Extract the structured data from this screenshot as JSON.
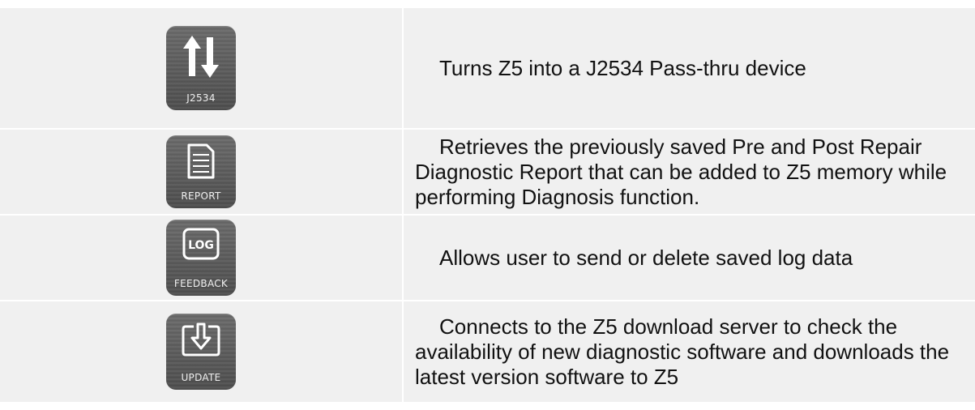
{
  "rows": [
    {
      "icon": "j2534-arrows-icon",
      "label": "J2534",
      "description": "Turns Z5 into a J2534 Pass-thru device"
    },
    {
      "icon": "report-document-icon",
      "label": "REPORT",
      "description": "Retrieves the previously saved Pre and Post Repair Diagnostic Report that can be added to Z5 memory while performing Diagnosis function."
    },
    {
      "icon": "log-feedback-icon",
      "label": "FEEDBACK",
      "icon_text": "LOG",
      "description": "Allows user to send or delete saved log data"
    },
    {
      "icon": "update-download-icon",
      "label": "UPDATE",
      "description": "Connects to the Z5 download server to check the availability of new diagnostic software and downloads the latest version software to Z5"
    }
  ]
}
